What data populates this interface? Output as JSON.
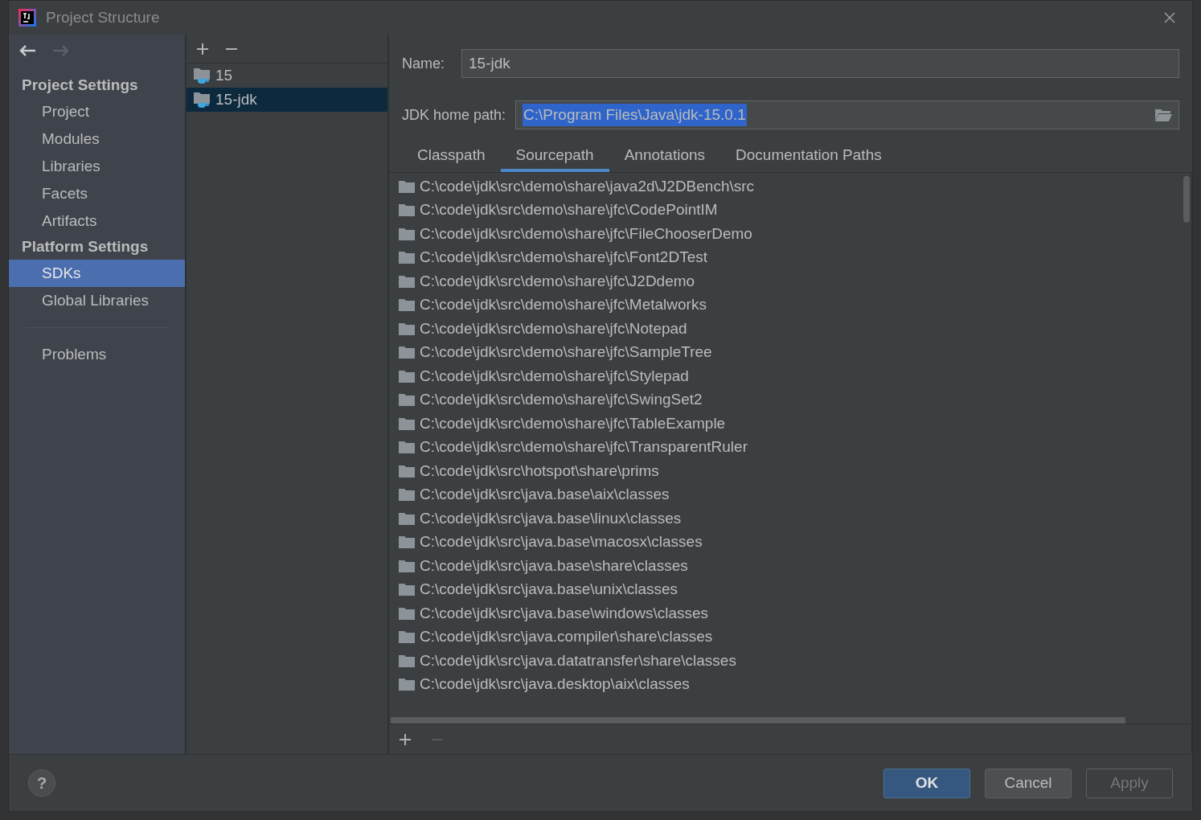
{
  "window": {
    "title": "Project Structure"
  },
  "sidebar": {
    "sections": [
      {
        "title": "Project Settings",
        "items": [
          {
            "label": "Project",
            "selected": false
          },
          {
            "label": "Modules",
            "selected": false
          },
          {
            "label": "Libraries",
            "selected": false
          },
          {
            "label": "Facets",
            "selected": false
          },
          {
            "label": "Artifacts",
            "selected": false
          }
        ]
      },
      {
        "title": "Platform Settings",
        "items": [
          {
            "label": "SDKs",
            "selected": true
          },
          {
            "label": "Global Libraries",
            "selected": false
          }
        ]
      }
    ],
    "extra_items": [
      {
        "label": "Problems",
        "selected": false
      }
    ]
  },
  "sdk_list": [
    {
      "label": "15",
      "selected": false
    },
    {
      "label": "15-jdk",
      "selected": true
    }
  ],
  "name_field": {
    "label": "Name:",
    "value": "15-jdk"
  },
  "home_path_field": {
    "label": "JDK home path:",
    "value": "C:\\Program Files\\Java\\jdk-15.0.1"
  },
  "tabs": [
    {
      "label": "Classpath",
      "selected": false
    },
    {
      "label": "Sourcepath",
      "selected": true
    },
    {
      "label": "Annotations",
      "selected": false
    },
    {
      "label": "Documentation Paths",
      "selected": false
    }
  ],
  "paths": [
    "C:\\code\\jdk\\src\\demo\\share\\java2d\\J2DBench\\src",
    "C:\\code\\jdk\\src\\demo\\share\\jfc\\CodePointIM",
    "C:\\code\\jdk\\src\\demo\\share\\jfc\\FileChooserDemo",
    "C:\\code\\jdk\\src\\demo\\share\\jfc\\Font2DTest",
    "C:\\code\\jdk\\src\\demo\\share\\jfc\\J2Ddemo",
    "C:\\code\\jdk\\src\\demo\\share\\jfc\\Metalworks",
    "C:\\code\\jdk\\src\\demo\\share\\jfc\\Notepad",
    "C:\\code\\jdk\\src\\demo\\share\\jfc\\SampleTree",
    "C:\\code\\jdk\\src\\demo\\share\\jfc\\Stylepad",
    "C:\\code\\jdk\\src\\demo\\share\\jfc\\SwingSet2",
    "C:\\code\\jdk\\src\\demo\\share\\jfc\\TableExample",
    "C:\\code\\jdk\\src\\demo\\share\\jfc\\TransparentRuler",
    "C:\\code\\jdk\\src\\hotspot\\share\\prims",
    "C:\\code\\jdk\\src\\java.base\\aix\\classes",
    "C:\\code\\jdk\\src\\java.base\\linux\\classes",
    "C:\\code\\jdk\\src\\java.base\\macosx\\classes",
    "C:\\code\\jdk\\src\\java.base\\share\\classes",
    "C:\\code\\jdk\\src\\java.base\\unix\\classes",
    "C:\\code\\jdk\\src\\java.base\\windows\\classes",
    "C:\\code\\jdk\\src\\java.compiler\\share\\classes",
    "C:\\code\\jdk\\src\\java.datatransfer\\share\\classes",
    "C:\\code\\jdk\\src\\java.desktop\\aix\\classes"
  ],
  "help": "?",
  "buttons": [
    {
      "label": "OK",
      "kind": "primary"
    },
    {
      "label": "Cancel",
      "kind": "normal"
    },
    {
      "label": "Apply",
      "kind": "disabled"
    }
  ]
}
